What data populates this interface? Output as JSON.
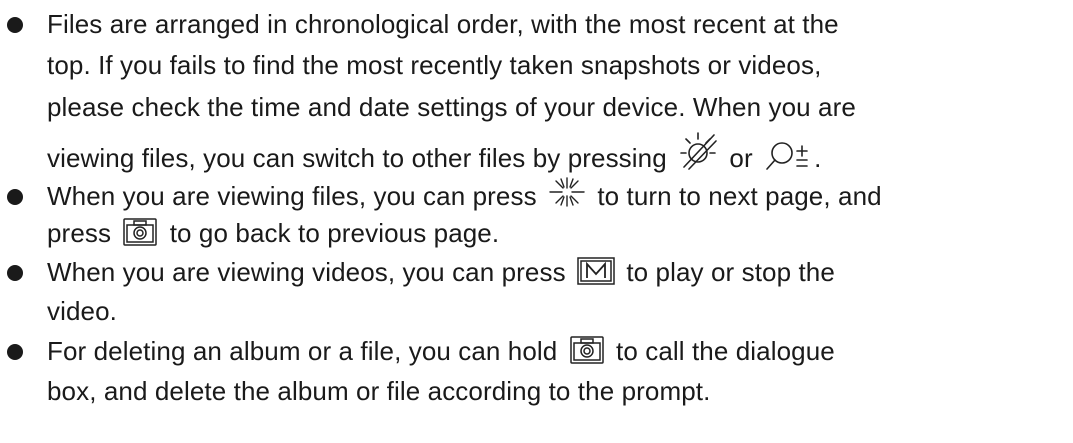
{
  "bullets": [
    {
      "lines": [
        "Files are arranged in chronological order, with the most recent at the",
        "top. If you fails to find the most recently taken snapshots or videos,",
        "please check the time and date settings of your device. When you are"
      ],
      "last_parts": [
        "viewing files, you can switch to other files by pressing ",
        " or ",
        "."
      ],
      "icons": [
        "sun-slash-icon",
        "zoom-plus-minus-icon"
      ]
    },
    {
      "l1_parts": [
        "When you are viewing files, you can press ",
        " to turn to next page, and"
      ],
      "l2_parts": [
        "press ",
        " to go back to previous page."
      ],
      "icons": [
        "snowflake-icon",
        "camera-icon"
      ]
    },
    {
      "l1_parts": [
        "When you are viewing videos, you can press ",
        " to play or stop the"
      ],
      "l2": "video.",
      "icons": [
        "m-button-icon"
      ]
    },
    {
      "l1_parts": [
        "For deleting an album or a file, you can hold ",
        " to call the dialogue"
      ],
      "l2": "box, and delete the album or file according to the prompt.",
      "icons": [
        "camera-icon"
      ]
    }
  ]
}
